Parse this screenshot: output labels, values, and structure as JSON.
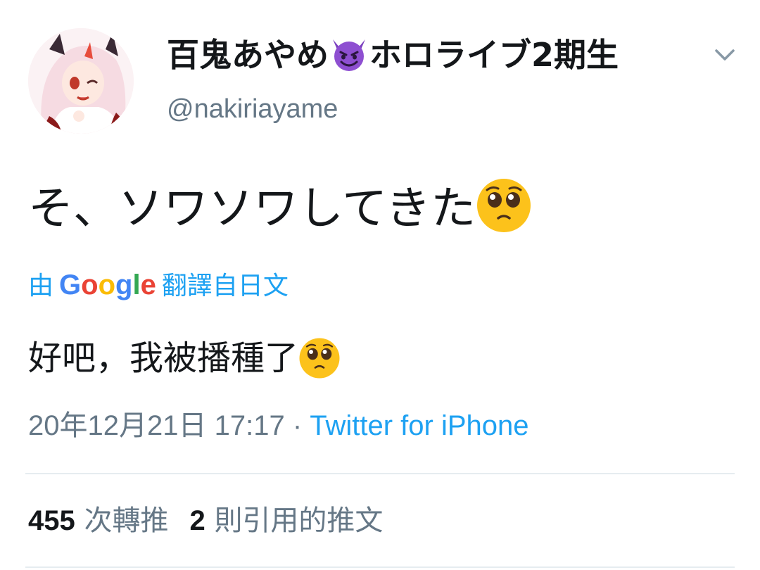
{
  "user": {
    "display_name_prefix": "百鬼あやめ",
    "display_name_emoji": "smiling-imp-emoji",
    "display_name_suffix": "ホロライブ2期生",
    "handle": "@nakiriayame"
  },
  "tweet": {
    "text": "そ、ソワソワしてきた",
    "text_emoji": "pleading-face-emoji"
  },
  "translation": {
    "prefix": "由",
    "provider": "Google",
    "suffix": "翻譯自日文",
    "text": "好吧，我被播種了",
    "text_emoji": "pleading-face-emoji"
  },
  "meta": {
    "timestamp": "20年12月21日 17:17",
    "separator": "·",
    "source": "Twitter for iPhone"
  },
  "stats": {
    "retweets_count": "455",
    "retweets_label": "次轉推",
    "quotes_count": "2",
    "quotes_label": "則引用的推文"
  },
  "colors": {
    "link": "#1da1f2",
    "secondary_text": "#657786",
    "primary_text": "#14171a",
    "divider": "#e6ecf0"
  }
}
